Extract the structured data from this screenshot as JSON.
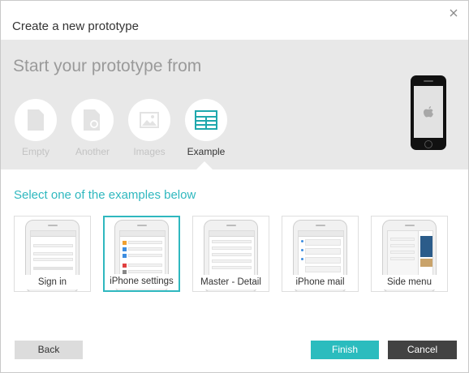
{
  "dialog": {
    "title": "Create a new prototype",
    "close_icon": "close-icon"
  },
  "banner": {
    "heading": "Start your prototype from",
    "sources": [
      {
        "label": "Empty",
        "icon": "blank-page-icon",
        "active": false
      },
      {
        "label": "Another",
        "icon": "page-copy-icon",
        "active": false
      },
      {
        "label": "Images",
        "icon": "image-icon",
        "active": false
      },
      {
        "label": "Example",
        "icon": "example-grid-icon",
        "active": true
      }
    ],
    "device_icon": "iphone-icon"
  },
  "examples": {
    "heading": "Select one of the examples below",
    "items": [
      {
        "label": "Sign in",
        "selected": false
      },
      {
        "label": "iPhone settings",
        "selected": true
      },
      {
        "label": "Master - Detail",
        "selected": false
      },
      {
        "label": "iPhone mail",
        "selected": false
      },
      {
        "label": "Side menu",
        "selected": false
      }
    ]
  },
  "footer": {
    "back_label": "Back",
    "finish_label": "Finish",
    "cancel_label": "Cancel"
  },
  "colors": {
    "accent": "#2fb8bf",
    "finish": "#2bbcbe",
    "cancel": "#424242",
    "banner_bg": "#e8e8e8"
  }
}
